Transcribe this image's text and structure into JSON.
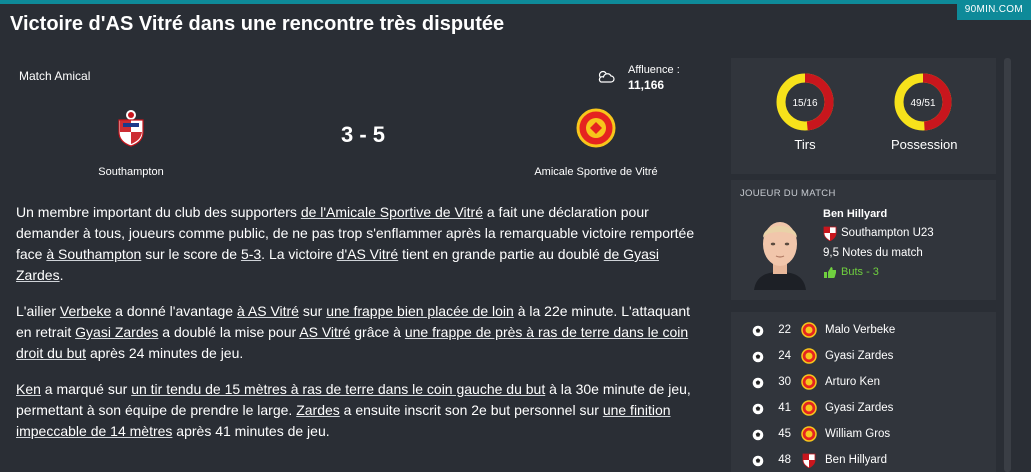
{
  "brand": "90MIN.COM",
  "headline": "Victoire d'AS Vitré dans une rencontre très disputée",
  "match": {
    "type": "Match Amical",
    "attendance_label": "Affluence :",
    "attendance_value": "11,166",
    "score": "3 - 5",
    "home_team": "Southampton",
    "away_team": "Amicale Sportive de Vitré"
  },
  "stats": {
    "shots": {
      "value_text": "15/16",
      "home": 15,
      "away": 16,
      "label": "Tirs"
    },
    "possession": {
      "value_text": "49/51",
      "home": 49,
      "away": 51,
      "label": "Possession"
    }
  },
  "colors": {
    "home": "#c8161d",
    "away": "#f7e21b",
    "accent": "#0e8a99",
    "goal": "#6fcf3f"
  },
  "player_of_match": {
    "title": "JOUEUR DU MATCH",
    "name": "Ben Hillyard",
    "club": "Southampton U23",
    "rating": "9,5 Notes du match",
    "goals": "Buts - 3"
  },
  "scorers": [
    {
      "minute": "22",
      "team": "away",
      "name": "Malo Verbeke"
    },
    {
      "minute": "24",
      "team": "away",
      "name": "Gyasi Zardes"
    },
    {
      "minute": "30",
      "team": "away",
      "name": "Arturo Ken"
    },
    {
      "minute": "41",
      "team": "away",
      "name": "Gyasi Zardes"
    },
    {
      "minute": "45",
      "team": "away",
      "name": "William Gros"
    },
    {
      "minute": "48",
      "team": "home",
      "name": "Ben Hillyard"
    }
  ],
  "article": {
    "p1": [
      "Un membre important du club des supporters ",
      "de l'Amicale Sportive de Vitré",
      " a fait une déclaration pour demander à tous, joueurs comme public, de ne pas trop s'enflammer après la remarquable victoire remportée face ",
      "à Southampton",
      " sur le score de ",
      "5-3",
      ". La victoire ",
      "d'AS Vitré",
      " tient en grande partie au doublé ",
      "de Gyasi Zardes",
      "."
    ],
    "p2": [
      "L'ailier ",
      "Verbeke",
      " a donné l'avantage ",
      "à AS Vitré",
      " sur ",
      "une frappe bien placée de loin",
      " à la 22e minute. L'attaquant en retrait ",
      "Gyasi Zardes",
      " a doublé la mise pour ",
      "AS Vitré",
      " grâce à ",
      "une frappe de près à ras de terre dans le coin droit du but",
      " après 24 minutes de jeu."
    ],
    "p3": [
      "Ken",
      " a marqué sur ",
      "un tir tendu de 15 mètres à ras de terre dans le coin gauche du but",
      " à la 30e minute de jeu, permettant à son équipe de prendre le large. ",
      "Zardes",
      " a ensuite inscrit son 2e but personnel sur ",
      "une finition impeccable de 14 mètres",
      " après 41 minutes de jeu."
    ]
  }
}
